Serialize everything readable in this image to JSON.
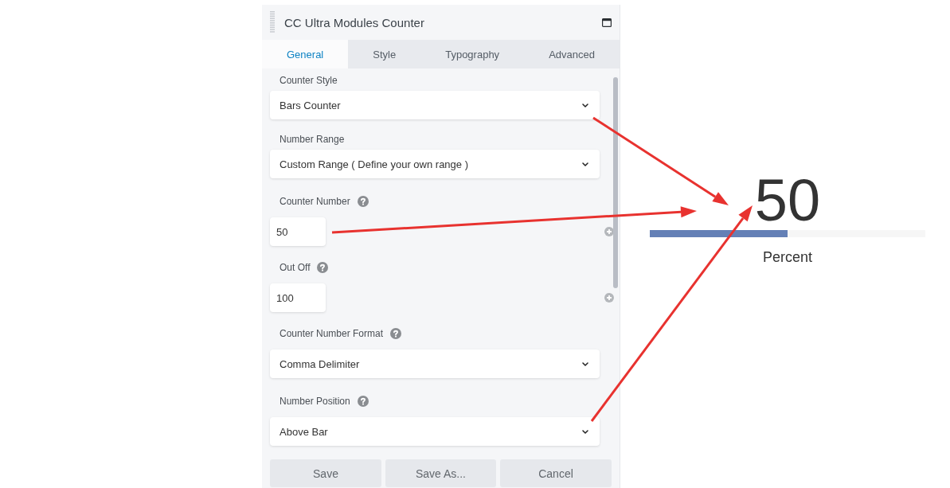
{
  "panel": {
    "title": "CC Ultra Modules Counter"
  },
  "tabs": [
    {
      "label": "General",
      "selected": true
    },
    {
      "label": "Style",
      "selected": false
    },
    {
      "label": "Typography",
      "selected": false
    },
    {
      "label": "Advanced",
      "selected": false
    }
  ],
  "fields": [
    {
      "kind": "select",
      "label": "Counter Style",
      "help": false,
      "value": "Bars Counter"
    },
    {
      "kind": "select",
      "label": "Number Range",
      "help": false,
      "value": "Custom Range ( Define your own range )"
    },
    {
      "kind": "number",
      "label": "Counter Number",
      "help": true,
      "value": "50"
    },
    {
      "kind": "number",
      "label": "Out Off",
      "help": true,
      "value": "100"
    },
    {
      "kind": "select",
      "label": "Counter Number Format",
      "help": true,
      "value": "Comma Delimiter"
    },
    {
      "kind": "select",
      "label": "Number Position",
      "help": true,
      "value": "Above Bar"
    }
  ],
  "buttons": [
    "Save",
    "Save As...",
    "Cancel"
  ],
  "preview": {
    "number": "50",
    "level": 0.5,
    "caption": "Percent"
  }
}
